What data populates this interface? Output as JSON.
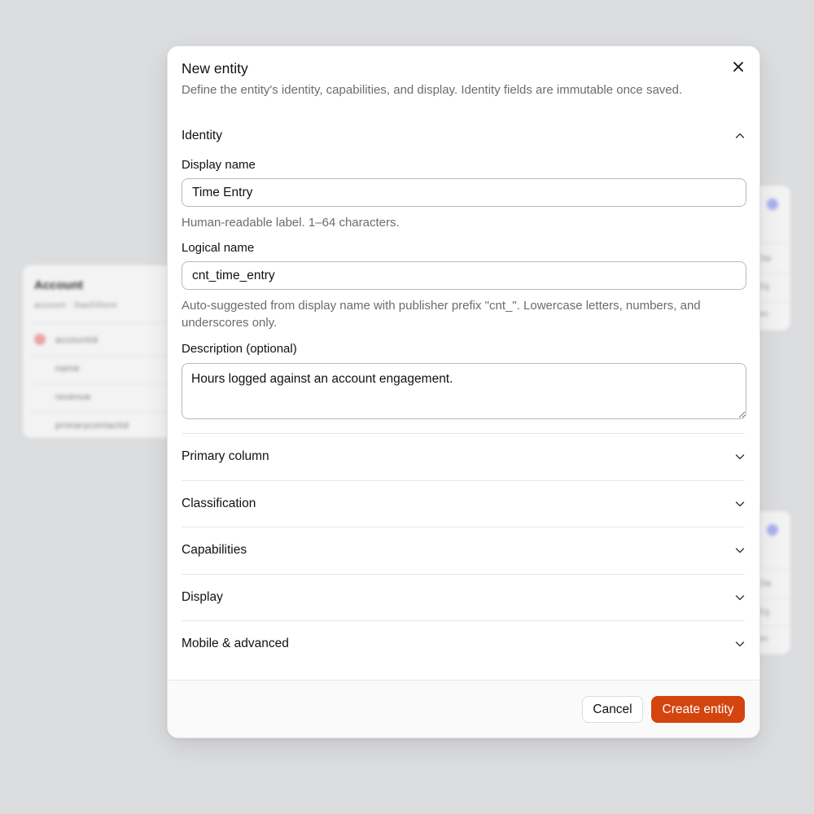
{
  "background": {
    "left_card": {
      "title": "Account",
      "subtitle": "account · SaaSStore",
      "rows": [
        "accountid",
        "name",
        "revenue",
        "primarycontactid"
      ]
    },
    "right_card_top": {
      "words": [
        "Ow",
        "Eq",
        "en"
      ]
    },
    "right_card_bottom": {
      "words": [
        "Ow",
        "Eq",
        "en"
      ]
    }
  },
  "modal": {
    "title": "New entity",
    "description": "Define the entity's identity, capabilities, and display. Identity fields are immutable once saved.",
    "close_icon": "close-icon"
  },
  "identity": {
    "section_label": "Identity",
    "display_name": {
      "label": "Display name",
      "value": "Time Entry",
      "help": "Human-readable label. 1–64 characters."
    },
    "logical_name": {
      "label": "Logical name",
      "value": "cnt_time_entry",
      "help": "Auto-suggested from display name with publisher prefix \"cnt_\". Lowercase letters, numbers, and underscores only."
    },
    "description": {
      "label": "Description (optional)",
      "value": "Hours logged against an account engagement."
    }
  },
  "sections": [
    {
      "label": "Primary column"
    },
    {
      "label": "Classification"
    },
    {
      "label": "Capabilities"
    },
    {
      "label": "Display"
    },
    {
      "label": "Mobile & advanced"
    }
  ],
  "footer": {
    "cancel_label": "Cancel",
    "create_label": "Create entity"
  },
  "colors": {
    "accent": "#d4440f",
    "backdrop": "#dcdddf"
  }
}
